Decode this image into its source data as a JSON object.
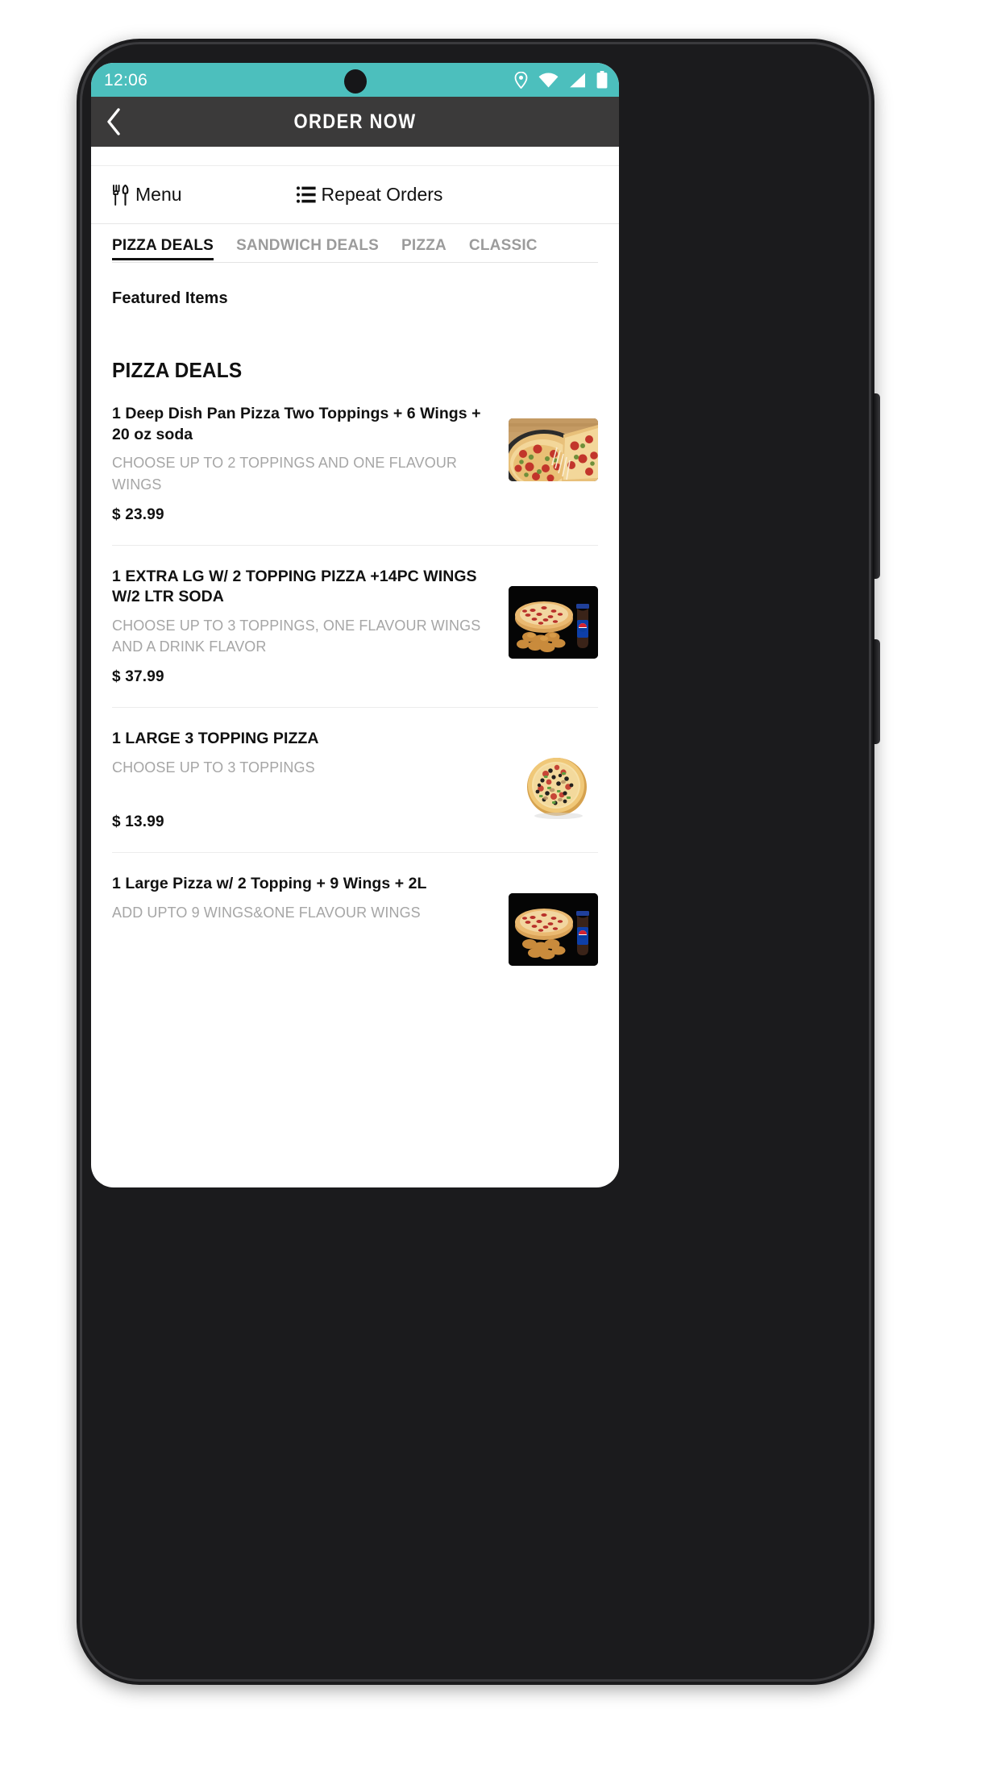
{
  "status_bar": {
    "time": "12:06",
    "icons": [
      "location-pin-icon",
      "wifi-icon",
      "cellular-signal-icon",
      "battery-icon"
    ],
    "background_color": "#4cbfbd"
  },
  "app_bar": {
    "title": "ORDER NOW",
    "back_icon": "chevron-left-icon",
    "background_color": "#3b3a3a"
  },
  "quick_actions": {
    "menu": {
      "label": "Menu",
      "icon": "fork-knife-icon"
    },
    "repeat_orders": {
      "label": "Repeat Orders",
      "icon": "list-icon"
    }
  },
  "tabs": [
    {
      "label": "PIZZA DEALS",
      "active": true
    },
    {
      "label": "SANDWICH DEALS",
      "active": false
    },
    {
      "label": "PIZZA",
      "active": false
    },
    {
      "label": "CLASSIC",
      "active": false
    }
  ],
  "featured": {
    "title": "Featured Items"
  },
  "section": {
    "title": "PIZZA DEALS"
  },
  "items": [
    {
      "name": "1 Deep Dish Pan Pizza Two Toppings + 6 Wings + 20 oz soda",
      "description": "CHOOSE UP TO 2 TOPPINGS AND ONE FLAVOUR WINGS",
      "price": "$ 23.99",
      "image": "pepperoni-pan-pizza-slice-lift-photo"
    },
    {
      "name": "1 EXTRA LG W/ 2 TOPPING PIZZA +14PC WINGS W/2 LTR SODA",
      "description": "CHOOSE UP TO 3 TOPPINGS, ONE FLAVOUR WINGS AND A DRINK FLAVOR",
      "price": "$ 37.99",
      "image": "pizza-wings-pepsi-bottle-photo"
    },
    {
      "name": "1 LARGE 3 TOPPING PIZZA",
      "description": "CHOOSE UP TO 3 TOPPINGS",
      "price": "$ 13.99",
      "image": "supreme-pizza-white-background-photo"
    },
    {
      "name": "1 Large Pizza w/ 2 Topping + 9 Wings + 2L",
      "description": "ADD UPTO 9 WINGS&ONE FLAVOUR WINGS",
      "price": "",
      "image": "pizza-wings-pepsi-bottle-photo"
    }
  ],
  "colors": {
    "accent_teal": "#4cbfbd",
    "header_dark": "#3b3a3a",
    "text_primary": "#111111",
    "text_muted": "#a6a6a6",
    "divider": "#ececec"
  }
}
